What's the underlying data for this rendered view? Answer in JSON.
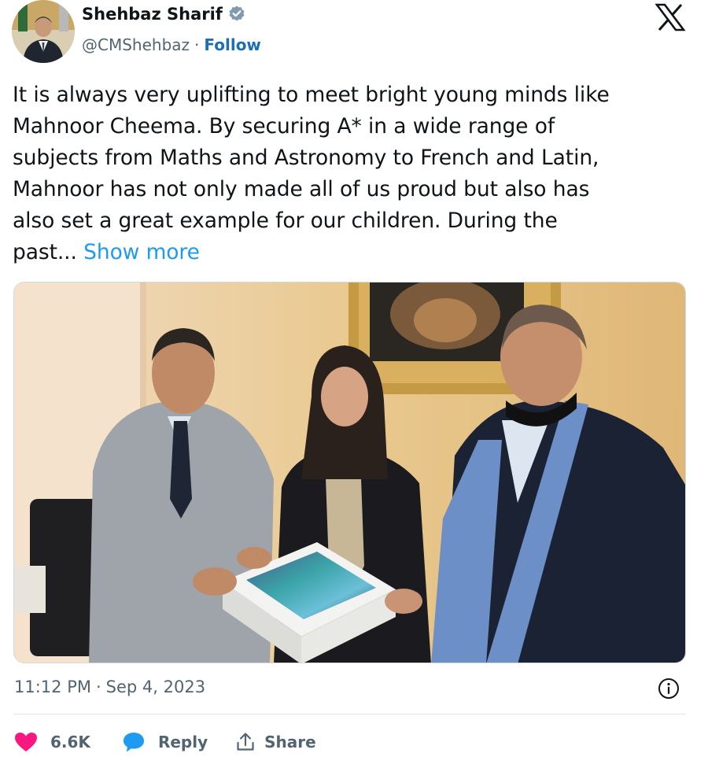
{
  "author": {
    "name": "Shehbaz Sharif",
    "handle": "@CMShehbaz",
    "separator": "·",
    "follow_label": "Follow",
    "verified": true
  },
  "tweet": {
    "lines": [
      "It is always very uplifting to meet bright young minds like",
      "Mahnoor Cheema. By securing A* in a wide range of",
      "subjects from Maths and Astronomy to French and Latin,",
      "Mahnoor has not only made all of us proud but also has",
      "also set a great example for our children. During the",
      "past..."
    ],
    "show_more_label": "Show more"
  },
  "meta": {
    "time": "11:12 PM",
    "separator": "·",
    "date": "Sep 4, 2023"
  },
  "actions": {
    "likes": "6.6K",
    "reply_label": "Reply",
    "share_label": "Share"
  },
  "icons": {
    "verified": "verified-badge-icon",
    "brand": "x-logo-icon",
    "info": "info-icon",
    "like": "heart-icon",
    "reply": "speech-bubble-icon",
    "share": "share-arrow-icon"
  },
  "colors": {
    "link": "#1d9bf0",
    "follow": "#1d6fb3",
    "like": "#f91880",
    "reply": "#1d9bf0",
    "text": "#0f1419",
    "muted": "#536471"
  }
}
